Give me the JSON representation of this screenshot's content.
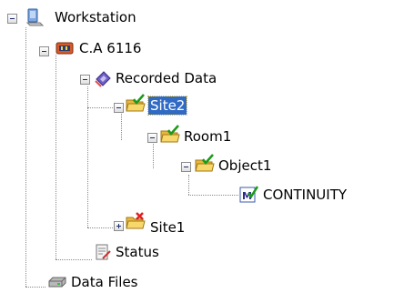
{
  "tree": {
    "workstation": {
      "label": "Workstation",
      "icon": "computer-icon"
    },
    "device": {
      "label": "C.A 6116",
      "icon": "device-icon"
    },
    "recorded_data": {
      "label": "Recorded Data",
      "icon": "data-disk-icon"
    },
    "site2": {
      "label": "Site2",
      "icon": "folder-check-icon",
      "selected": true
    },
    "room1": {
      "label": "Room1",
      "icon": "folder-check-icon"
    },
    "object1": {
      "label": "Object1",
      "icon": "folder-check-icon"
    },
    "continuity": {
      "label": "CONTINUITY",
      "icon": "measurement-check-icon"
    },
    "site1": {
      "label": "Site1",
      "icon": "folder-error-icon"
    },
    "status": {
      "label": "Status",
      "icon": "status-icon"
    },
    "data_files": {
      "label": "Data Files",
      "icon": "drive-icon"
    }
  },
  "colors": {
    "selection": "#316ac5",
    "folder": "#f3c94f",
    "check": "#1a9a1a",
    "error": "#e02020"
  }
}
